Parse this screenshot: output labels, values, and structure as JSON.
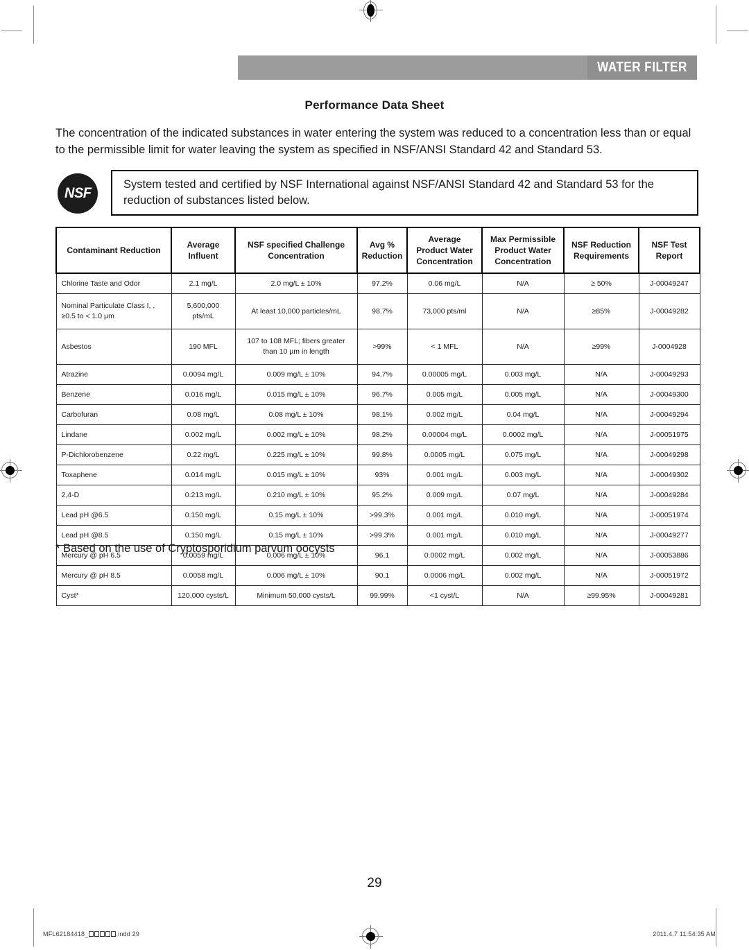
{
  "banner": {
    "title": "WATER FILTER",
    "bg_color": "#9c9c9c",
    "accent_color": "#8f8f8f",
    "text_color": "#ffffff"
  },
  "page_title": "Performance Data Sheet",
  "intro": "The concentration of the indicated substances in water entering the system was reduced to a concentration less than or equal to the permissible limit for water leaving the system as specified in NSF/ANSI Standard 42 and Standard 53.",
  "certification": {
    "logo_text": "NSF",
    "text": "System tested and certified by NSF International against NSF/ANSI Standard 42 and Standard 53 for the reduction of substances listed below."
  },
  "table": {
    "headers": [
      "Contaminant Reduction",
      "Average Influent",
      "NSF specified Challenge Concentration",
      "Avg % Reduction",
      "Average Product Water Concentration",
      "Max Permissible Product Water Concentration",
      "NSF Reduction Requirements",
      "NSF Test Report"
    ],
    "header_lines": [
      [
        "Contaminant Reduction"
      ],
      [
        "Average",
        "Influent"
      ],
      [
        "NSF specified Challenge",
        "Concentration"
      ],
      [
        "Avg %",
        "Reduction"
      ],
      [
        "Average",
        "Product Water",
        "Concentration"
      ],
      [
        "Max Permissible",
        "Product Water",
        "Concentration"
      ],
      [
        "NSF Reduction",
        "Requirements"
      ],
      [
        "NSF Test",
        "Report"
      ]
    ],
    "rows": [
      {
        "name": [
          "Chlorine Taste and Odor"
        ],
        "influent": [
          "2.1 mg/L"
        ],
        "challenge": [
          "2.0 mg/L ± 10%"
        ],
        "reduction": [
          "97.2%"
        ],
        "product": [
          "0.06 mg/L"
        ],
        "max_permissible": [
          "N/A"
        ],
        "requirement": [
          "≥ 50%"
        ],
        "report": [
          "J-00049247"
        ],
        "tall": false
      },
      {
        "name": [
          "Nominal Particulate Class I, ,",
          "≥0.5 to < 1.0 µm"
        ],
        "influent": [
          "5,600,000",
          "pts/mL"
        ],
        "challenge": [
          "At least 10,000 particles/mL"
        ],
        "reduction": [
          "98.7%"
        ],
        "product": [
          "73,000 pts/ml"
        ],
        "max_permissible": [
          "N/A"
        ],
        "requirement": [
          "≥85%"
        ],
        "report": [
          "J-00049282"
        ],
        "tall": true
      },
      {
        "name": [
          "Asbestos"
        ],
        "influent": [
          "190 MFL"
        ],
        "challenge": [
          "107 to 108 MFL; fibers greater",
          "than 10 µm in length"
        ],
        "reduction": [
          ">99%"
        ],
        "product": [
          "< 1 MFL"
        ],
        "max_permissible": [
          "N/A"
        ],
        "requirement": [
          "≥99%"
        ],
        "report": [
          "J-0004928"
        ],
        "tall": true
      },
      {
        "name": [
          "Atrazine"
        ],
        "influent": [
          "0.0094 mg/L"
        ],
        "challenge": [
          "0.009 mg/L ± 10%"
        ],
        "reduction": [
          "94.7%"
        ],
        "product": [
          "0.00005 mg/L"
        ],
        "max_permissible": [
          "0.003 mg/L"
        ],
        "requirement": [
          "N/A"
        ],
        "report": [
          "J-00049293"
        ],
        "tall": false
      },
      {
        "name": [
          "Benzene"
        ],
        "influent": [
          "0.016 mg/L"
        ],
        "challenge": [
          "0.015 mg/L ± 10%"
        ],
        "reduction": [
          "96.7%"
        ],
        "product": [
          "0.005 mg/L"
        ],
        "max_permissible": [
          "0.005 mg/L"
        ],
        "requirement": [
          "N/A"
        ],
        "report": [
          "J-00049300"
        ],
        "tall": false
      },
      {
        "name": [
          "Carbofuran"
        ],
        "influent": [
          "0.08 mg/L"
        ],
        "challenge": [
          "0.08 mg/L ± 10%"
        ],
        "reduction": [
          "98.1%"
        ],
        "product": [
          "0.002 mg/L"
        ],
        "max_permissible": [
          "0.04 mg/L"
        ],
        "requirement": [
          "N/A"
        ],
        "report": [
          "J-00049294"
        ],
        "tall": false
      },
      {
        "name": [
          "Lindane"
        ],
        "influent": [
          "0.002 mg/L"
        ],
        "challenge": [
          "0.002 mg/L ± 10%"
        ],
        "reduction": [
          "98.2%"
        ],
        "product": [
          "0.00004 mg/L"
        ],
        "max_permissible": [
          "0.0002 mg/L"
        ],
        "requirement": [
          "N/A"
        ],
        "report": [
          "J-00051975"
        ],
        "tall": false
      },
      {
        "name": [
          "P-Dichlorobenzene"
        ],
        "influent": [
          "0.22 mg/L"
        ],
        "challenge": [
          "0.225 mg/L ± 10%"
        ],
        "reduction": [
          "99.8%"
        ],
        "product": [
          "0.0005 mg/L"
        ],
        "max_permissible": [
          "0.075 mg/L"
        ],
        "requirement": [
          "N/A"
        ],
        "report": [
          "J-00049298"
        ],
        "tall": false
      },
      {
        "name": [
          "Toxaphene"
        ],
        "influent": [
          "0.014 mg/L"
        ],
        "challenge": [
          "0.015 mg/L ± 10%"
        ],
        "reduction": [
          "93%"
        ],
        "product": [
          "0.001 mg/L"
        ],
        "max_permissible": [
          "0.003 mg/L"
        ],
        "requirement": [
          "N/A"
        ],
        "report": [
          "J-00049302"
        ],
        "tall": false
      },
      {
        "name": [
          "2,4-D"
        ],
        "influent": [
          "0.213 mg/L"
        ],
        "challenge": [
          "0.210 mg/L ± 10%"
        ],
        "reduction": [
          "95.2%"
        ],
        "product": [
          "0.009 mg/L"
        ],
        "max_permissible": [
          "0.07 mg/L"
        ],
        "requirement": [
          "N/A"
        ],
        "report": [
          "J-00049284"
        ],
        "tall": false
      },
      {
        "name": [
          "Lead pH @6.5"
        ],
        "influent": [
          "0.150 mg/L"
        ],
        "challenge": [
          "0.15 mg/L ± 10%"
        ],
        "reduction": [
          ">99.3%"
        ],
        "product": [
          "0.001 mg/L"
        ],
        "max_permissible": [
          "0.010 mg/L"
        ],
        "requirement": [
          "N/A"
        ],
        "report": [
          "J-00051974"
        ],
        "tall": false
      },
      {
        "name": [
          "Lead pH @8.5"
        ],
        "influent": [
          "0.150 mg/L"
        ],
        "challenge": [
          "0.15 mg/L ± 10%"
        ],
        "reduction": [
          ">99.3%"
        ],
        "product": [
          "0.001 mg/L"
        ],
        "max_permissible": [
          "0.010 mg/L"
        ],
        "requirement": [
          "N/A"
        ],
        "report": [
          "J-00049277"
        ],
        "tall": false
      },
      {
        "name": [
          "Mercury @ pH 6.5"
        ],
        "influent": [
          "0.0059 mg/L"
        ],
        "challenge": [
          "0.006 mg/L ± 10%"
        ],
        "reduction": [
          "96.1"
        ],
        "product": [
          "0.0002 mg/L"
        ],
        "max_permissible": [
          "0.002 mg/L"
        ],
        "requirement": [
          "N/A"
        ],
        "report": [
          "J-00053886"
        ],
        "tall": false
      },
      {
        "name": [
          "Mercury @ pH 8.5"
        ],
        "influent": [
          "0.0058 mg/L"
        ],
        "challenge": [
          "0.006 mg/L ± 10%"
        ],
        "reduction": [
          "90.1"
        ],
        "product": [
          "0.0006 mg/L"
        ],
        "max_permissible": [
          "0.002 mg/L"
        ],
        "requirement": [
          "N/A"
        ],
        "report": [
          "J-00051972"
        ],
        "tall": false
      },
      {
        "name": [
          "Cyst*"
        ],
        "influent": [
          "120,000 cysts/L"
        ],
        "challenge": [
          "Minimum 50,000 cysts/L"
        ],
        "reduction": [
          "99.99%"
        ],
        "product": [
          "<1 cyst/L"
        ],
        "max_permissible": [
          "N/A"
        ],
        "requirement": [
          "≥99.95%"
        ],
        "report": [
          "J-00049281"
        ],
        "tall": false
      }
    ]
  },
  "footnote": "* Based on the use of Cryptosporidium parvum oocysts",
  "page_number": "29",
  "footer": {
    "left_prefix": "MFL62184418_",
    "left_suffix": ".indd   29",
    "missing_glyph_count": 5,
    "right": "2011.4.7   11:54:35 AM"
  }
}
